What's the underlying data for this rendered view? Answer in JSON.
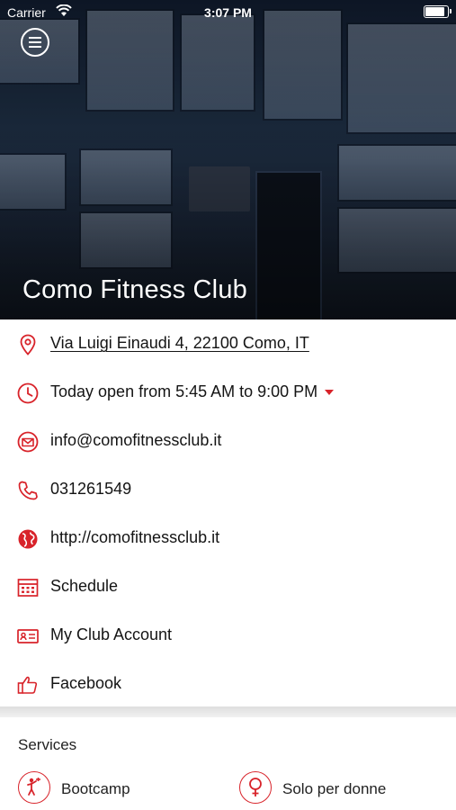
{
  "status_bar": {
    "carrier": "Carrier",
    "time": "3:07 PM"
  },
  "club": {
    "name": "Como Fitness Club"
  },
  "info": {
    "address": "Via Luigi Einaudi 4, 22100 Como, IT",
    "hours": "Today open from 5:45 AM to 9:00 PM",
    "email": "info@comofitnessclub.it",
    "phone": "031261549",
    "website": "http://comofitnessclub.it",
    "schedule": "Schedule",
    "account": "My Club Account",
    "facebook": "Facebook"
  },
  "services": {
    "title": "Services",
    "items": [
      {
        "label": "Bootcamp",
        "icon": "bootcamp-icon"
      },
      {
        "label": "Solo per donne",
        "icon": "female-icon"
      }
    ]
  },
  "colors": {
    "accent": "#d8232a",
    "text": "#141414"
  }
}
